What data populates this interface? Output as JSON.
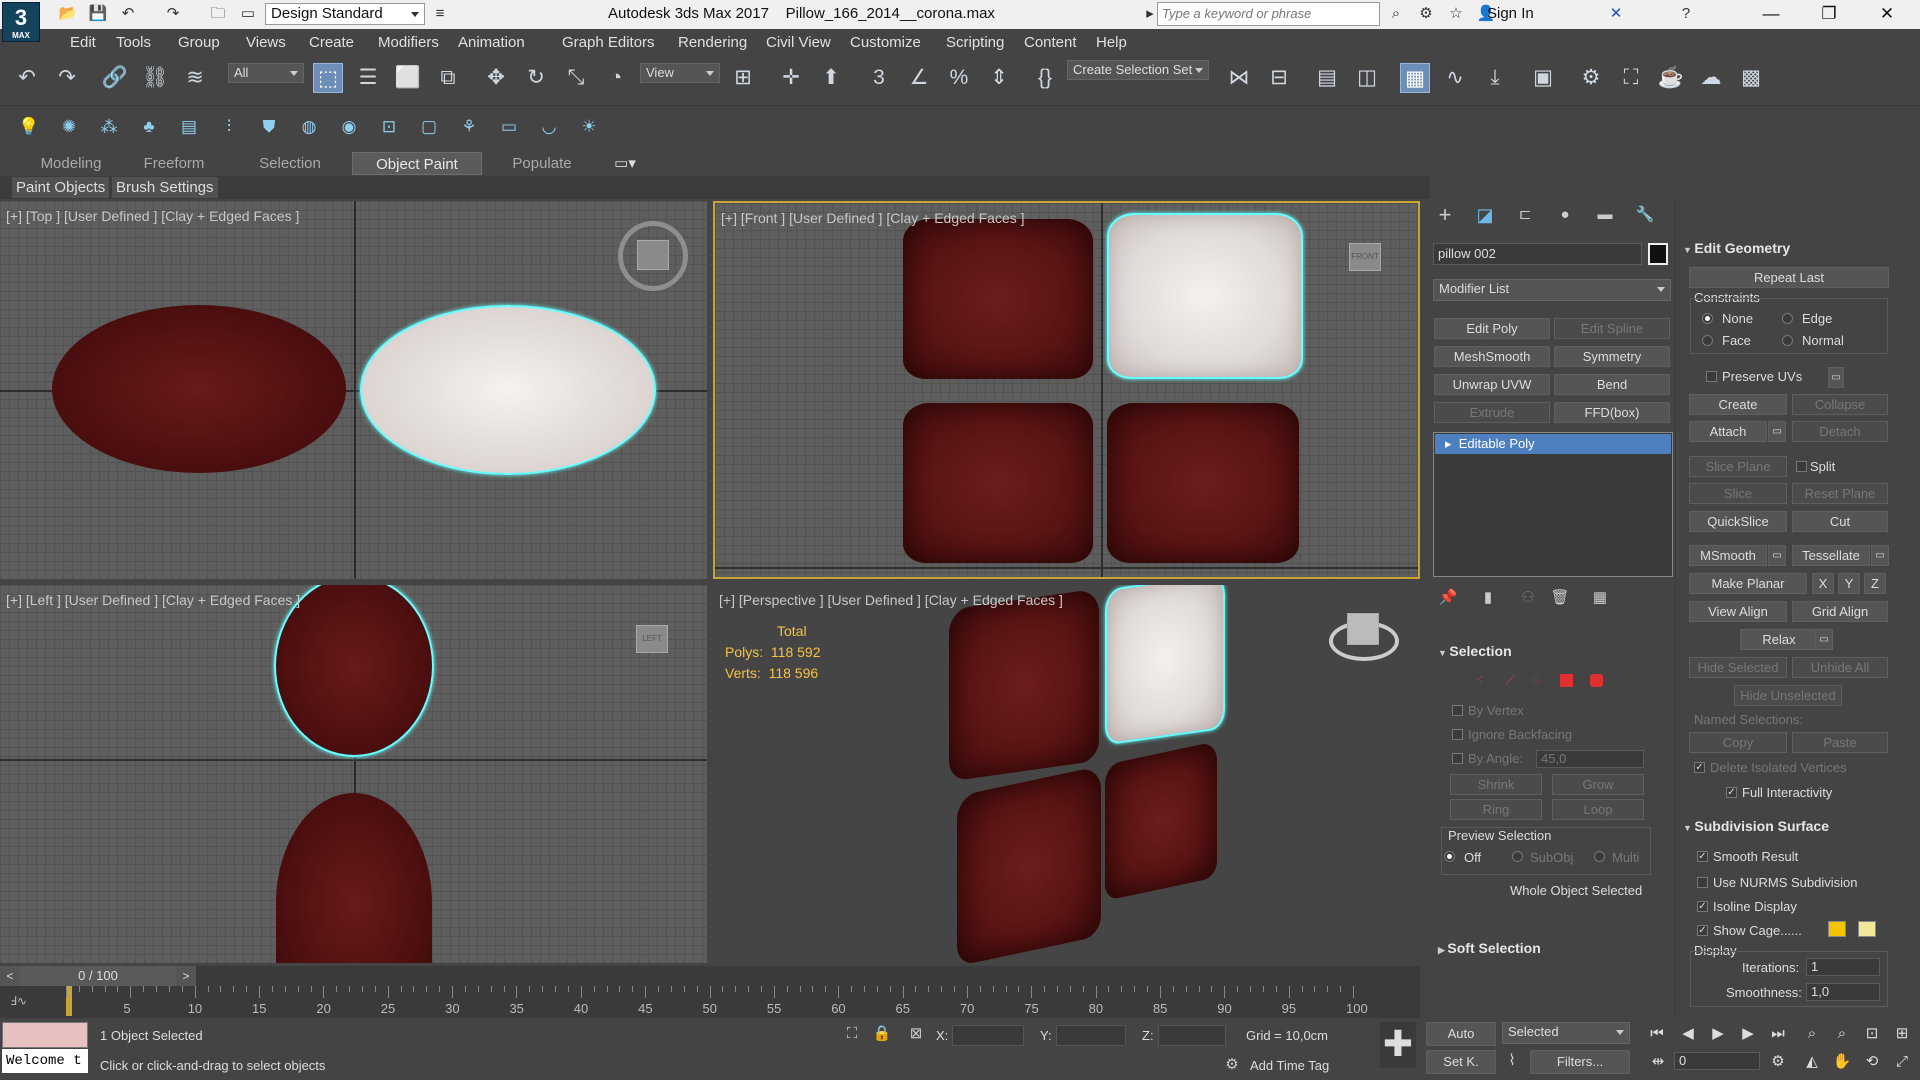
{
  "app": {
    "logo_text": "3",
    "logo_sub": "MAX",
    "title": "Autodesk 3ds Max 2017",
    "file_name": "Pillow_166_2014__corona.max",
    "workspace": "Design Standard"
  },
  "search": {
    "placeholder": "Type a keyword or phrase"
  },
  "account": {
    "sign_in": "Sign In"
  },
  "menu": [
    "Edit",
    "Tools",
    "Group",
    "Views",
    "Create",
    "Modifiers",
    "Animation",
    "Graph Editors",
    "Rendering",
    "Civil View",
    "Customize",
    "Scripting",
    "Content",
    "Help"
  ],
  "toolbar": {
    "filter_value": "All",
    "ref_coord": "View",
    "selection_set": "Create Selection Set"
  },
  "ribbon": {
    "tabs": [
      "Modeling",
      "Freeform",
      "Selection",
      "Object Paint",
      "Populate"
    ],
    "active_tab": "Object Paint",
    "sub_buttons": [
      "Paint Objects",
      "Brush Settings"
    ]
  },
  "viewports": {
    "top": {
      "label": "[+] [Top ] [User Defined ] [Clay + Edged Faces ]"
    },
    "front": {
      "label": "[+] [Front ] [User Defined ] [Clay + Edged Faces ]",
      "cube_text": "FRONT"
    },
    "left": {
      "label": "[+] [Left ] [User Defined ] [Clay + Edged Faces ]",
      "cube_text": "LEFT"
    },
    "perspective": {
      "label": "[+] [Perspective ] [User Defined ] [Clay + Edged Faces ]",
      "stats": {
        "total": "Total",
        "polys_label": "Polys:",
        "polys": "118 592",
        "verts_label": "Verts:",
        "verts": "118 596"
      }
    }
  },
  "command_panel": {
    "object_name": "pillow 002",
    "modifier_list": "Modifier List",
    "modifier_buttons": [
      "Edit Poly",
      "Edit Spline",
      "MeshSmooth",
      "Symmetry",
      "Unwrap UVW",
      "Bend",
      "Extrude",
      "FFD(box)"
    ],
    "stack_item": "Editable Poly",
    "selection": {
      "title": "Selection",
      "by_vertex": "By Vertex",
      "ignore_backfacing": "Ignore Backfacing",
      "by_angle": "By Angle:",
      "angle": "45,0",
      "shrink": "Shrink",
      "grow": "Grow",
      "ring": "Ring",
      "loop": "Loop",
      "preview": "Preview Selection",
      "off": "Off",
      "subobj": "SubObj",
      "multi": "Multi",
      "status": "Whole Object Selected"
    },
    "soft_selection": "Soft Selection"
  },
  "edit_geometry": {
    "title": "Edit Geometry",
    "repeat_last": "Repeat Last",
    "constraints": "Constraints",
    "none": "None",
    "edge": "Edge",
    "face": "Face",
    "normal": "Normal",
    "preserve_uvs": "Preserve UVs",
    "create": "Create",
    "collapse": "Collapse",
    "attach": "Attach",
    "detach": "Detach",
    "slice_plane": "Slice Plane",
    "split": "Split",
    "slice": "Slice",
    "reset_plane": "Reset Plane",
    "quickslice": "QuickSlice",
    "cut": "Cut",
    "msmooth": "MSmooth",
    "tessellate": "Tessellate",
    "make_planar": "Make Planar",
    "x": "X",
    "y": "Y",
    "z": "Z",
    "view_align": "View Align",
    "grid_align": "Grid Align",
    "relax": "Relax",
    "hide_selected": "Hide Selected",
    "unhide_all": "Unhide All",
    "hide_unselected": "Hide Unselected",
    "named_selections": "Named Selections:",
    "copy": "Copy",
    "paste": "Paste",
    "delete_isolated": "Delete Isolated Vertices",
    "full_interactivity": "Full Interactivity"
  },
  "subdivision": {
    "title": "Subdivision Surface",
    "smooth_result": "Smooth Result",
    "use_nurms": "Use NURMS Subdivision",
    "isoline": "Isoline Display",
    "show_cage": "Show Cage......",
    "display": "Display",
    "iterations_label": "Iterations:",
    "iterations": "1",
    "smoothness_label": "Smoothness:",
    "smoothness": "1,0",
    "cage_color1": "#f5c400",
    "cage_color2": "#f2e89a"
  },
  "timeline": {
    "frame_display": "0 / 100",
    "ticks": [
      "5",
      "10",
      "15",
      "20",
      "25",
      "30",
      "35",
      "40",
      "45",
      "50",
      "55",
      "60",
      "65",
      "70",
      "75",
      "80",
      "85",
      "90",
      "95",
      "100"
    ]
  },
  "status": {
    "selected_count": "1 Object Selected",
    "prompt": "Click or click-and-drag to select objects",
    "listener": "Welcome t",
    "x_label": "X:",
    "y_label": "Y:",
    "z_label": "Z:",
    "grid": "Grid = 10,0cm",
    "add_time_tag": "Add Time Tag",
    "auto": "Auto",
    "set_key": "Set K.",
    "key_filter": "Selected",
    "filters": "Filters...",
    "frame": "0"
  },
  "colors": {
    "selection_highlight": "#66ffff",
    "pillow": "#5a1414",
    "active_tool": "#6d8fb7"
  }
}
